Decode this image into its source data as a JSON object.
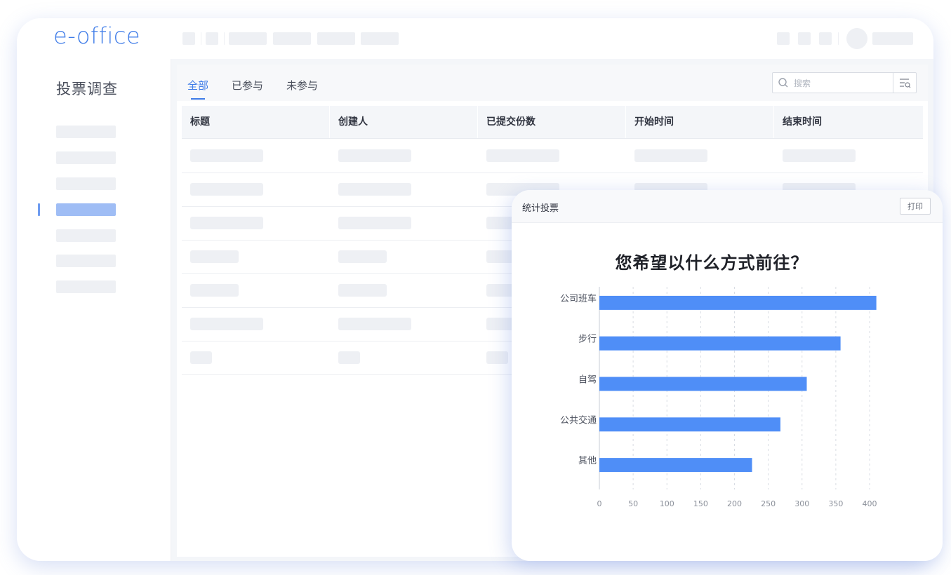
{
  "app": {
    "logo": "e-office"
  },
  "sidebar": {
    "title": "投票调查"
  },
  "tabs": [
    {
      "label": "全部",
      "active": true
    },
    {
      "label": "已参与",
      "active": false
    },
    {
      "label": "未参与",
      "active": false
    }
  ],
  "search": {
    "placeholder": "搜索"
  },
  "table": {
    "columns": [
      "标题",
      "创建人",
      "已提交份数",
      "开始时间",
      "结束时间"
    ]
  },
  "panel": {
    "title": "统计投票",
    "print_label": "打印"
  },
  "chart_data": {
    "type": "bar",
    "orientation": "horizontal",
    "title": "您希望以什么方式前往？",
    "categories": [
      "公司班车",
      "步行",
      "自驾",
      "公共交通",
      "其他"
    ],
    "values": [
      410,
      357,
      307,
      268,
      226
    ],
    "xlim": [
      0,
      400
    ],
    "xticks": [
      0,
      50,
      100,
      150,
      200,
      250,
      300,
      350,
      400
    ],
    "bar_color": "#4f8ef7",
    "grid": true
  },
  "colors": {
    "accent": "#3f7ce8",
    "bar": "#4f8ef7",
    "active_sidebar": "#9fbdf5"
  }
}
